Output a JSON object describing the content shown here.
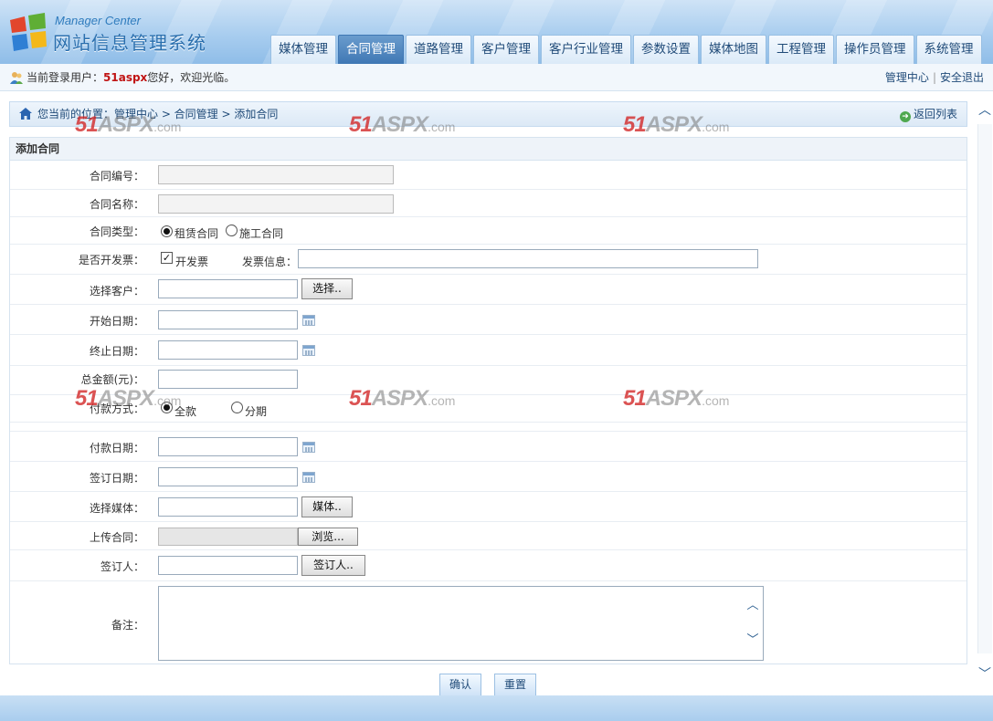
{
  "header": {
    "logo_sub": "Manager Center",
    "logo_title": "网站信息管理系统",
    "nav": [
      {
        "label": "媒体管理",
        "active": false
      },
      {
        "label": "合同管理",
        "active": true
      },
      {
        "label": "道路管理",
        "active": false
      },
      {
        "label": "客户管理",
        "active": false
      },
      {
        "label": "客户行业管理",
        "active": false
      },
      {
        "label": "参数设置",
        "active": false
      },
      {
        "label": "媒体地图",
        "active": false
      },
      {
        "label": "工程管理",
        "active": false
      },
      {
        "label": "操作员管理",
        "active": false
      },
      {
        "label": "系统管理",
        "active": false
      }
    ]
  },
  "userbar": {
    "prefix": "当前登录用户：",
    "username": "51aspx",
    "suffix": "您好，欢迎光临。",
    "link_center": "管理中心",
    "link_logout": "安全退出"
  },
  "breadcrumb": {
    "path": "您当前的位置：管理中心 > 合同管理 > 添加合同",
    "back": "返回列表"
  },
  "form": {
    "title": "添加合同",
    "contract_no_label": "合同编号：",
    "contract_no_value": "",
    "contract_name_label": "合同名称：",
    "contract_name_value": "",
    "contract_type_label": "合同类型：",
    "contract_type_options": [
      "租赁合同",
      "施工合同"
    ],
    "contract_type_selected": "租赁合同",
    "invoice_label": "是否开发票：",
    "invoice_check_label": "开发票",
    "invoice_checked": true,
    "invoice_info_label": "发票信息：",
    "invoice_info_value": "",
    "customer_label": "选择客户：",
    "customer_value": "",
    "customer_button": "选择..",
    "start_date_label": "开始日期：",
    "start_date_value": "",
    "end_date_label": "终止日期：",
    "end_date_value": "",
    "total_label": "总金额(元)：",
    "total_value": "",
    "payment_label": "付款方式：",
    "payment_options": [
      "全款",
      "分期"
    ],
    "payment_selected": "全款",
    "pay_date_label": "付款日期：",
    "pay_date_value": "",
    "sign_date_label": "签订日期：",
    "sign_date_value": "",
    "media_label": "选择媒体：",
    "media_value": "",
    "media_button": "媒体..",
    "upload_label": "上传合同：",
    "upload_button": "浏览...",
    "signer_label": "签订人：",
    "signer_value": "",
    "signer_button": "签订人..",
    "remark_label": "备注：",
    "remark_value": "",
    "confirm_button": "确认",
    "reset_button": "重置"
  },
  "watermark": {
    "num": "51",
    "text": "ASPX",
    "dom": ".com"
  },
  "colors": {
    "nav_active": "#3f77b4",
    "header_bg": "#a8cdef",
    "username": "#c01414",
    "link": "#1f4a78"
  }
}
